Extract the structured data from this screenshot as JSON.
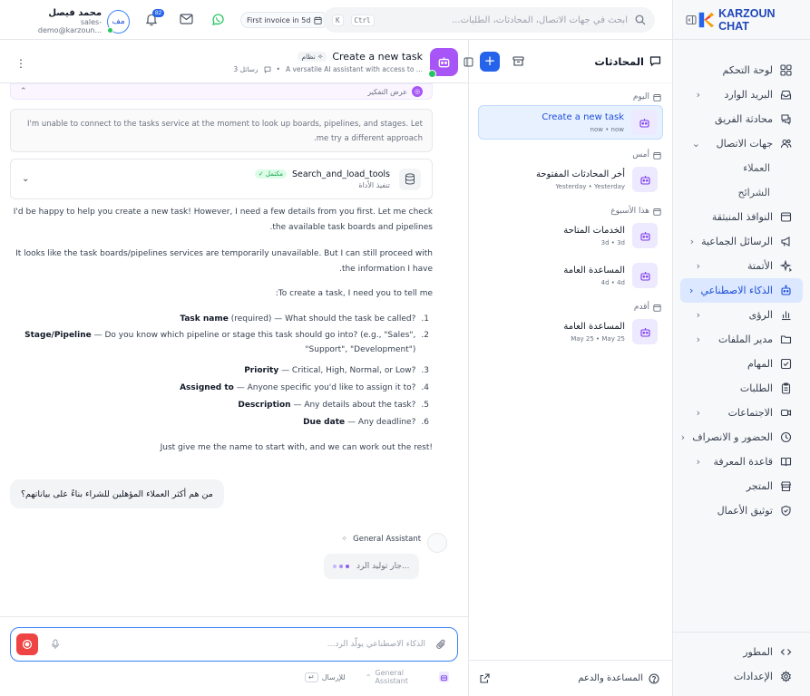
{
  "brand": {
    "name": "KARZOUN CHAT"
  },
  "sidebar": {
    "items": [
      {
        "label": "لوحة التحكم",
        "icon": "grid-icon",
        "chevron": false
      },
      {
        "label": "البريد الوارد",
        "icon": "inbox-icon",
        "chevron": true
      },
      {
        "label": "محادثة الفريق",
        "icon": "team-chat-icon",
        "chevron": false
      },
      {
        "label": "جهات الاتصال",
        "icon": "users-icon",
        "chevron": true,
        "expanded": true
      },
      {
        "label": "العملاء",
        "sub": true
      },
      {
        "label": "الشرائح",
        "sub": true
      },
      {
        "label": "النوافذ المنبثقة",
        "icon": "popup-icon",
        "chevron": false
      },
      {
        "label": "الرسائل الجماعية",
        "icon": "megaphone-icon",
        "chevron": true
      },
      {
        "label": "الأتمتة",
        "icon": "sparkles-icon",
        "chevron": true
      },
      {
        "label": "الذكاء الاصطناعي",
        "icon": "bot-icon",
        "chevron": true,
        "active": true
      },
      {
        "label": "الرؤى",
        "icon": "bar-chart-icon",
        "chevron": true
      },
      {
        "label": "مدير الملفات",
        "icon": "folder-icon",
        "chevron": true
      },
      {
        "label": "المهام",
        "icon": "checkbox-icon",
        "chevron": false
      },
      {
        "label": "الطلبات",
        "icon": "clipboard-icon",
        "chevron": false
      },
      {
        "label": "الاجتماعات",
        "icon": "video-icon",
        "chevron": true
      },
      {
        "label": "الحضور و الانصراف",
        "icon": "clock-icon",
        "chevron": true
      },
      {
        "label": "قاعدة المعرفة",
        "icon": "book-icon",
        "chevron": true
      },
      {
        "label": "المتجر",
        "icon": "store-icon",
        "chevron": false
      },
      {
        "label": "توثيق الأعمال",
        "icon": "shield-check-icon",
        "chevron": false
      }
    ],
    "bottom": [
      {
        "label": "المطور",
        "icon": "code-icon"
      },
      {
        "label": "الإعدادات",
        "icon": "settings-icon"
      }
    ]
  },
  "header": {
    "search_placeholder": "ابحث في جهات الاتصال، المحادثات، الطلبات...",
    "shortcut_k": "K",
    "shortcut_ctrl": "Ctrl",
    "invoice_pill": "First invoice in 5d",
    "notifications_count": "82",
    "user_name": "محمد فيصل",
    "user_email": "sales-demo@karzoun...",
    "user_initials": "مف"
  },
  "conversations": {
    "title": "المحادثات",
    "groups": [
      {
        "label": "اليوم",
        "items": [
          {
            "title": "Create a new task",
            "meta": "now • now",
            "selected": true
          }
        ]
      },
      {
        "label": "أمس",
        "items": [
          {
            "title": "أخر المحادثات المفتوحة",
            "meta": "Yesterday • Yesterday"
          }
        ]
      },
      {
        "label": "هذا الأسبوع",
        "items": [
          {
            "title": "الخدمات المتاحة",
            "meta": "3d • 3d"
          },
          {
            "title": "المساعدة العامة",
            "meta": "4d • 4d"
          }
        ]
      },
      {
        "label": "أقدم",
        "items": [
          {
            "title": "المساعدة العامة",
            "meta": "May 25 • May 25"
          }
        ]
      }
    ],
    "footer": "المساعدة والدعم"
  },
  "chat": {
    "title": "Create a new task",
    "system_tag": "نظام",
    "subtitle": "A versatile AI assistant with access to ...",
    "message_count": "3 رسائل",
    "thinking_label": "عرض التفكير",
    "thinking_text": "I'm unable to connect to the tasks service at the moment to look up boards, pipelines, and stages. Let me try a different approach.",
    "tool_name": "Search_and_load_tools",
    "tool_status": "مكتمل",
    "tool_sub": "تنفيذ الأداة",
    "para1": "I'd be happy to help you create a new task! However, I need a few details from you first. Let me check the available task boards and pipelines.",
    "para2": "It looks like the task boards/pipelines services are temporarily unavailable. But I can still proceed with the information I have.",
    "para3": "To create a task, I need you to tell me:",
    "list": [
      {
        "n": "1.",
        "b": "Task name",
        "t": " (required) — What should the task be called?"
      },
      {
        "n": "2.",
        "b": "Stage/Pipeline",
        "t": " — Do you know which pipeline or stage this task should go into? (e.g., \"Sales\", \"Support\", \"Development\")"
      },
      {
        "n": "3.",
        "b": "Priority",
        "t": " — Critical, High, Normal, or Low?"
      },
      {
        "n": "4.",
        "b": "Assigned to",
        "t": " — Anyone specific you'd like to assign it to?"
      },
      {
        "n": "5.",
        "b": "Description",
        "t": " — Any details about the task?"
      },
      {
        "n": "6.",
        "b": "Due date",
        "t": " — Any deadline?"
      }
    ],
    "para4": "Just give me the name to start with, and we can work out the rest!",
    "user_msg": "من هم أكثر العملاء المؤهلين للشراء بناءً على بياناتهم؟",
    "assistant_name": "General Assistant",
    "generating": "جار توليد الرد...",
    "composer_placeholder": "الذكاء الاصطناعي يولّد الرد...",
    "footer_agent": "General Assistant",
    "footer_send": "للإرسال",
    "footer_enter": "↵"
  },
  "colors": {
    "accent": "#2563eb",
    "bot": "#a855f7",
    "record": "#ef4444",
    "online": "#22c55e"
  }
}
